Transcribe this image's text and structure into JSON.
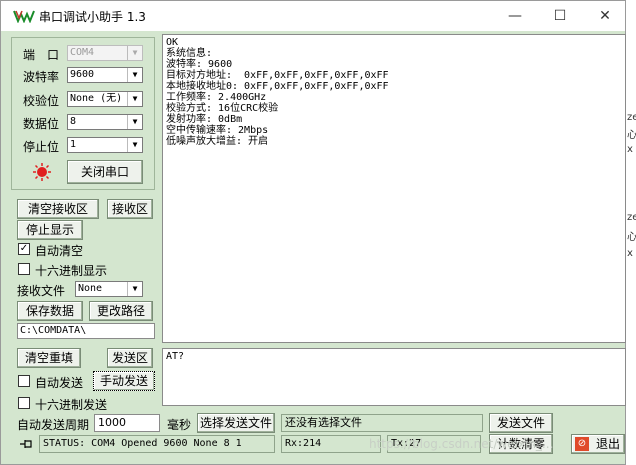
{
  "window": {
    "title": "串口调试小助手 1.3",
    "min": "—",
    "max": "☐",
    "close": "✕"
  },
  "settings": {
    "port_label": "端　口",
    "port_value": "COM4",
    "baud_label": "波特率",
    "baud_value": "9600",
    "parity_label": "校验位",
    "parity_value": "None (无)",
    "databits_label": "数据位",
    "databits_value": "8",
    "stopbits_label": "停止位",
    "stopbits_value": "1",
    "close_port_button": "关闭串口"
  },
  "receive": {
    "clear_button": "清空接收区",
    "area_button": "接收区",
    "stop_display_button": "停止显示",
    "auto_clear_label": "自动清空",
    "auto_clear_checked": "✓",
    "hex_display_label": "十六进制显示",
    "file_label": "接收文件",
    "file_value": "None",
    "save_data_button": "保存数据",
    "change_path_button": "更改路径",
    "path_value": "C:\\COMDATA\\",
    "content": "OK\n系统信息:\n波特率: 9600\n目标对方地址:  0xFF,0xFF,0xFF,0xFF,0xFF\n本地接收地址0: 0xFF,0xFF,0xFF,0xFF,0xFF\n工作频率: 2.400GHz\n校验方式: 16位CRC校验\n发射功率: 0dBm\n空中传输速率: 2Mbps\n低噪声放大增益: 开启"
  },
  "send": {
    "clear_button": "清空重填",
    "area_button": "发送区",
    "auto_send_label": "自动发送",
    "manual_send_button": "手动发送",
    "hex_send_label": "十六进制发送",
    "period_label": "自动发送周期",
    "period_value": "1000",
    "ms_label": "毫秒",
    "select_file_button": "选择发送文件",
    "file_status": "还没有选择文件",
    "send_file_button": "发送文件",
    "content": "AT?"
  },
  "statusbar": {
    "status": "STATUS: COM4 Opened 9600 None  8 1",
    "rx": "Rx:214",
    "tx": "Tx:27",
    "reset_count_button": "计数清零",
    "exit_button": "退出"
  },
  "watermark": "https://blog.csdn.net/weixin_...",
  "colors": {
    "panel": "#d4e6cf",
    "led": "#e02020"
  },
  "right_edge": [
    "ze",
    "心",
    "x",
    "ze",
    "心",
    "x"
  ]
}
